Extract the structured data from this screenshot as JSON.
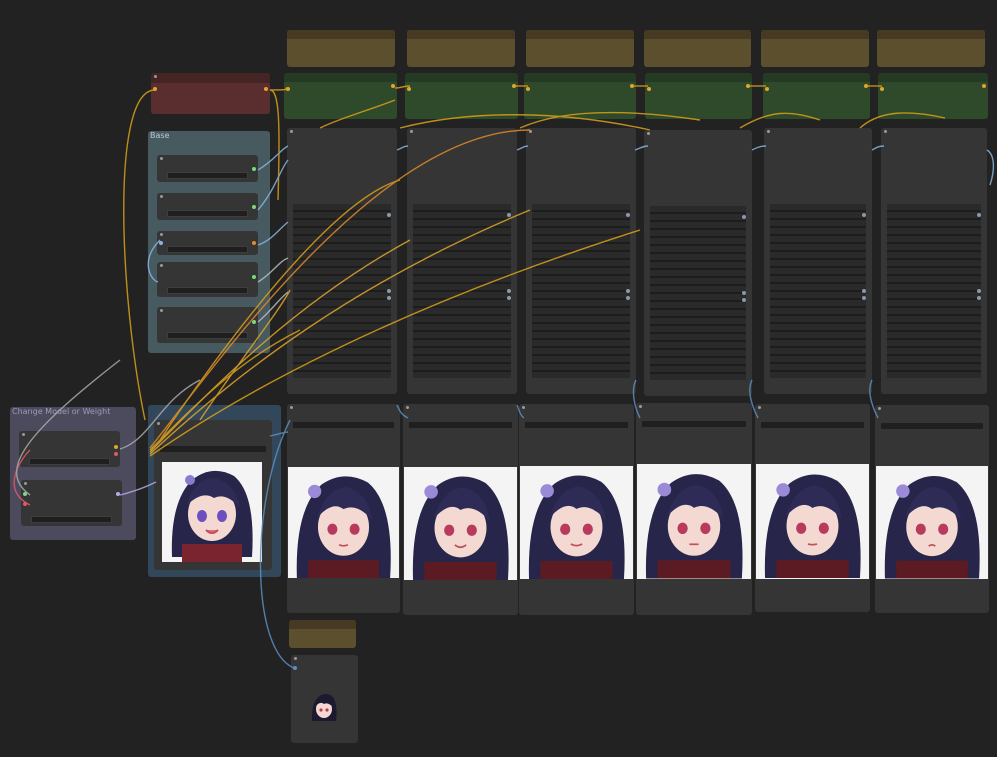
{
  "app": "ComfyUI",
  "groups": {
    "base": {
      "title": "Base",
      "color": "#4d6066"
    },
    "change_model": {
      "title": "Change Model or Weight",
      "color": "#4f4d61"
    }
  },
  "colors": {
    "canvas": "#222222",
    "node_body": "#353535",
    "link_yellow": "#d9a11a",
    "link_blue": "#5b8fbf",
    "link_orange": "#e28a2a",
    "header_brown": "#5b4f2e",
    "header_green": "#2e4a2a",
    "header_red": "#5a2e2e"
  },
  "columns": [
    {
      "id": 1
    },
    {
      "id": 2
    },
    {
      "id": 3
    },
    {
      "id": 4
    },
    {
      "id": 5
    },
    {
      "id": 6
    }
  ],
  "images": {
    "base_preview": "character-portrait-smiling",
    "column_previews": "character-portrait-neutral",
    "small_preview": "character-face-thumbnail"
  }
}
